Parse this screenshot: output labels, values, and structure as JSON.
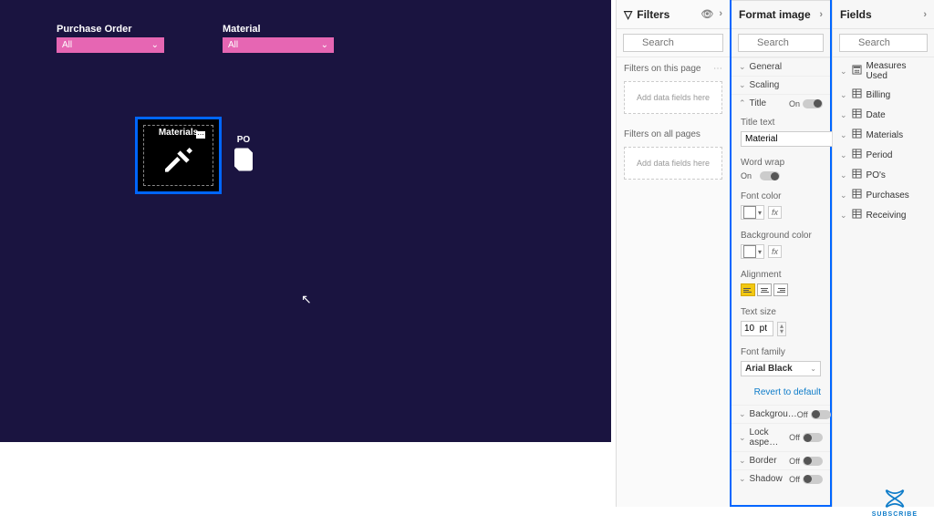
{
  "canvas": {
    "slicers": [
      {
        "label": "Purchase Order",
        "value": "All"
      },
      {
        "label": "Material",
        "value": "All"
      }
    ],
    "selected_tile_title": "Materials",
    "po_tile_label": "PO"
  },
  "filters": {
    "title": "Filters",
    "search_placeholder": "Search",
    "sections": {
      "page": {
        "label": "Filters on this page",
        "drop_hint": "Add data fields here"
      },
      "all": {
        "label": "Filters on all pages",
        "drop_hint": "Add data fields here"
      }
    }
  },
  "format": {
    "title": "Format image",
    "search_placeholder": "Search",
    "groups": {
      "general": "General",
      "scaling": "Scaling",
      "title": "Title",
      "background": "Backgrou…",
      "lock_aspect": "Lock aspe…",
      "border": "Border",
      "shadow": "Shadow"
    },
    "title_on": "On",
    "toggle_off_label": "Off",
    "title_props": {
      "title_text_label": "Title text",
      "title_text_value": "Material",
      "word_wrap_label": "Word wrap",
      "word_wrap_on": "On",
      "font_color_label": "Font color",
      "bg_color_label": "Background color",
      "alignment_label": "Alignment",
      "text_size_label": "Text size",
      "text_size_value": "10  pt",
      "font_family_label": "Font family",
      "font_family_value": "Arial Black",
      "revert": "Revert to default"
    }
  },
  "fields": {
    "title": "Fields",
    "search_placeholder": "Search",
    "tables": [
      {
        "name": "Measures Used",
        "icon": "calc"
      },
      {
        "name": "Billing",
        "icon": "table"
      },
      {
        "name": "Date",
        "icon": "table"
      },
      {
        "name": "Materials",
        "icon": "table"
      },
      {
        "name": "Period",
        "icon": "table"
      },
      {
        "name": "PO's",
        "icon": "table"
      },
      {
        "name": "Purchases",
        "icon": "table"
      },
      {
        "name": "Receiving",
        "icon": "table"
      }
    ]
  },
  "subscribe_label": "SUBSCRIBE"
}
